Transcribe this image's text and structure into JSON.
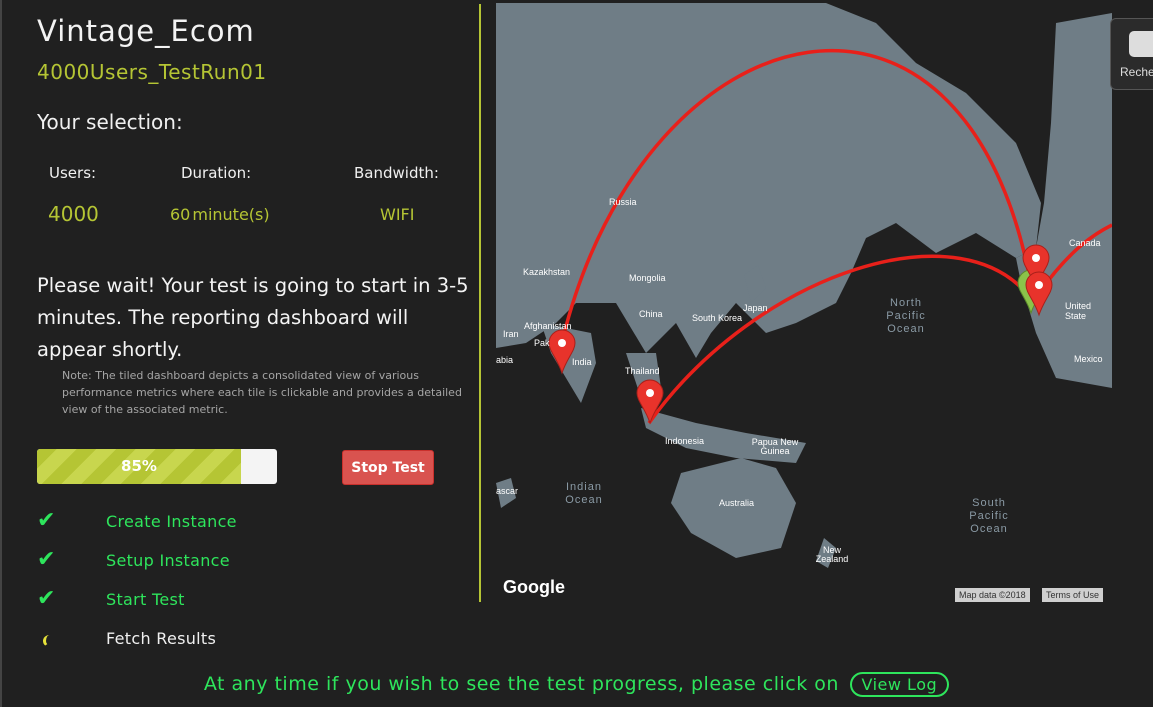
{
  "app": {
    "title": "Vintage_Ecom",
    "subtitle": "4000Users_TestRun01",
    "selection_heading": "Your selection:"
  },
  "selection": {
    "users_label": "Users:",
    "users_value": "4000",
    "duration_label": "Duration:",
    "duration_value": "60",
    "duration_unit": "minute(s)",
    "bandwidth_label": "Bandwidth:",
    "bandwidth_value": "WIFI"
  },
  "status": {
    "wait_message": "Please wait! Your test is going to start in 3-5 minutes. The reporting dashboard will appear shortly.",
    "note": "Note: The tiled dashboard depicts a consolidated view of various performance metrics where each tile is clickable and provides a detailed view of the associated metric.",
    "progress_percent": 85,
    "progress_text": "85%",
    "stop_label": "Stop Test"
  },
  "steps": [
    {
      "label": "Create Instance",
      "state": "done"
    },
    {
      "label": "Setup Instance",
      "state": "done"
    },
    {
      "label": "Start Test",
      "state": "done"
    },
    {
      "label": "Fetch Results",
      "state": "loading"
    }
  ],
  "footer": {
    "message": "At any time if you wish to see the test progress, please click on",
    "link_label": "View Log"
  },
  "map": {
    "labels": {
      "russia": "Russia",
      "kazakhstan": "Kazakhstan",
      "mongolia": "Mongolia",
      "china": "China",
      "afghanistan": "Afghanistan",
      "iran": "Iran",
      "pakistan": "Pak",
      "india": "India",
      "arabia": "abia",
      "south_korea": "South Korea",
      "japan": "Japan",
      "thailand": "Thailand",
      "indonesia": "Indonesia",
      "png": "Papua New Guinea",
      "australia": "Australia",
      "new_zealand": "New Zealand",
      "canada": "Canada",
      "united_states": "United State",
      "mexico": "Mexico",
      "madagascar": "ascar"
    },
    "oceans": {
      "north_pacific": "North Pacific Ocean",
      "indian": "Indian Ocean",
      "south_pacific": "South Pacific Ocean"
    },
    "brand": "Google",
    "attribution": "Map data ©2018",
    "terms": "Terms of Use",
    "colors": {
      "land": "#6f7d86",
      "route": "#e8201a",
      "marker": "#e8332b"
    }
  },
  "side_widget": {
    "label": "Reche"
  }
}
